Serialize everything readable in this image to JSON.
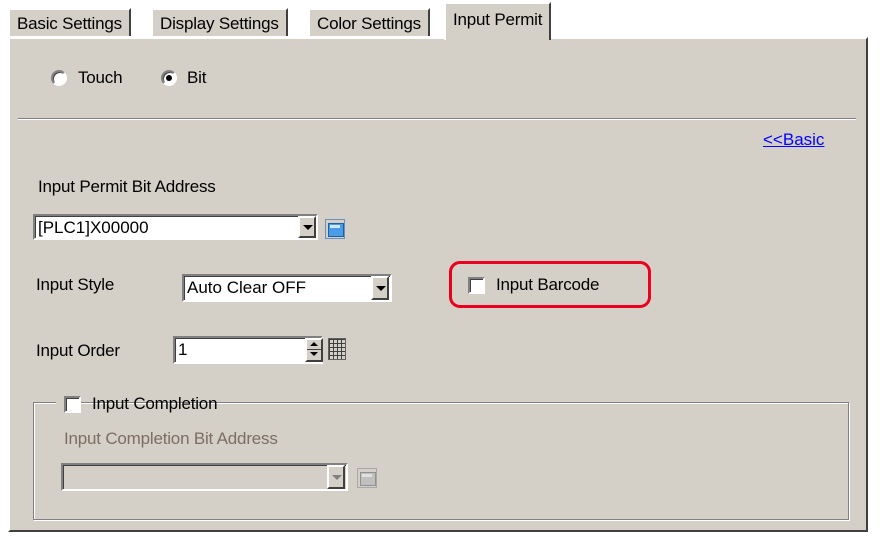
{
  "tabs": [
    {
      "label": "Basic Settings"
    },
    {
      "label": "Display Settings"
    },
    {
      "label": "Color Settings"
    },
    {
      "label": "Input Permit",
      "active": true
    }
  ],
  "mode": {
    "options": [
      "Touch",
      "Bit"
    ],
    "selected": "Bit"
  },
  "basic_link": "<<Basic",
  "permit_bit": {
    "label": "Input Permit Bit Address",
    "value": "[PLC1]X00000"
  },
  "input_style": {
    "label": "Input Style",
    "value": "Auto Clear OFF"
  },
  "input_barcode": {
    "label": "Input Barcode",
    "checked": false,
    "highlight_color": "#e8001c"
  },
  "input_order": {
    "label": "Input Order",
    "value": "1"
  },
  "input_completion": {
    "label": "Input Completion",
    "checked": false,
    "address_label": "Input Completion Bit Address",
    "address_value": ""
  },
  "colors": {
    "panel_bg": "#d4d0c8",
    "link": "#0000ff",
    "disabled_text": "#7d6d62"
  }
}
